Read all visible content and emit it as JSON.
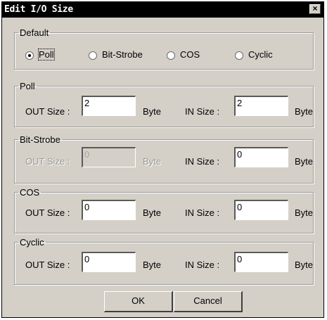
{
  "dialog": {
    "title": "Edit I/O Size",
    "close_glyph": "×"
  },
  "default_group": {
    "legend": "Default",
    "options": [
      {
        "label": "Poll",
        "selected": true
      },
      {
        "label": "Bit-Strobe",
        "selected": false
      },
      {
        "label": "COS",
        "selected": false
      },
      {
        "label": "Cyclic",
        "selected": false
      }
    ]
  },
  "groups": {
    "poll": {
      "legend": "Poll",
      "out_label": "OUT Size :",
      "out_value": "2",
      "out_unit": "Byte",
      "in_label": "IN Size :",
      "in_value": "2",
      "in_unit": "Byte"
    },
    "bitstrobe": {
      "legend": "Bit-Strobe",
      "out_label": "OUT Size :",
      "out_value": "0",
      "out_unit": "Byte",
      "in_label": "IN Size :",
      "in_value": "0",
      "in_unit": "Byte",
      "out_disabled": true
    },
    "cos": {
      "legend": "COS",
      "out_label": "OUT Size :",
      "out_value": "0",
      "out_unit": "Byte",
      "in_label": "IN Size :",
      "in_value": "0",
      "in_unit": "Byte"
    },
    "cyclic": {
      "legend": "Cyclic",
      "out_label": "OUT Size :",
      "out_value": "0",
      "out_unit": "Byte",
      "in_label": "IN Size :",
      "in_value": "0",
      "in_unit": "Byte"
    }
  },
  "buttons": {
    "ok": "OK",
    "cancel": "Cancel"
  }
}
